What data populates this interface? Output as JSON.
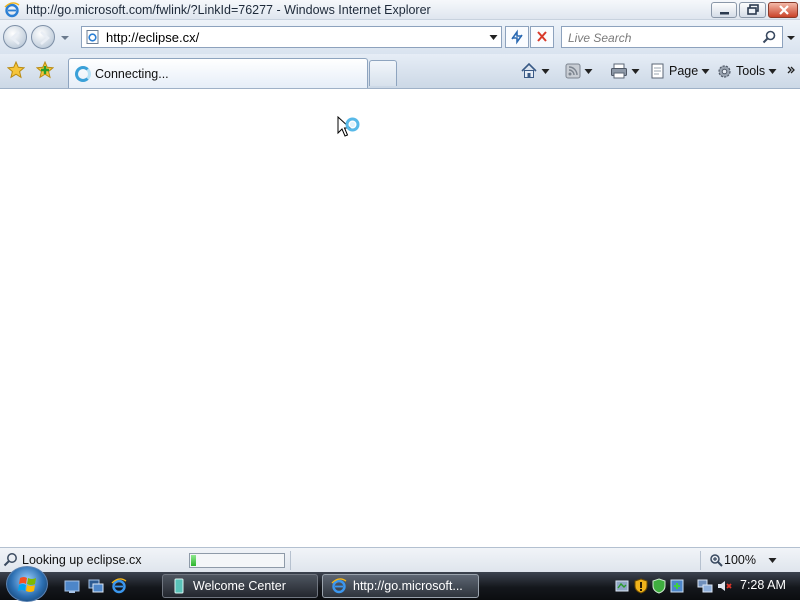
{
  "window": {
    "title": "http://go.microsoft.com/fwlink/?LinkId=76277 - Windows Internet Explorer"
  },
  "addressbar": {
    "url": "http://eclipse.cx/"
  },
  "search": {
    "placeholder": "Live Search"
  },
  "tab": {
    "label": "Connecting..."
  },
  "commandbar": {
    "page_label": "Page",
    "tools_label": "Tools"
  },
  "statusbar": {
    "text": "Looking up eclipse.cx",
    "progress": 0.05,
    "zoom": "100%"
  },
  "taskbar": {
    "tasks": [
      {
        "label": "Welcome Center"
      },
      {
        "label": "http://go.microsoft..."
      }
    ],
    "clock": "7:28 AM"
  },
  "colors": {
    "accent": "#3aa0d8",
    "progress_fill": "#2db52d",
    "close_button": "#c9432a"
  },
  "icons": [
    "ie-logo-icon",
    "back-arrow-icon",
    "forward-arrow-icon",
    "page-icon",
    "refresh-icon",
    "stop-icon",
    "search-icon",
    "favorites-star-icon",
    "add-favorites-icon",
    "home-icon",
    "feeds-icon",
    "print-icon",
    "page-icon",
    "gear-icon",
    "globe-search-icon",
    "zoom-icon",
    "windows-logo-icon",
    "show-desktop-icon",
    "switch-windows-icon",
    "welcome-center-icon",
    "network-icon",
    "security-shield-icon",
    "volume-muted-icon"
  ]
}
